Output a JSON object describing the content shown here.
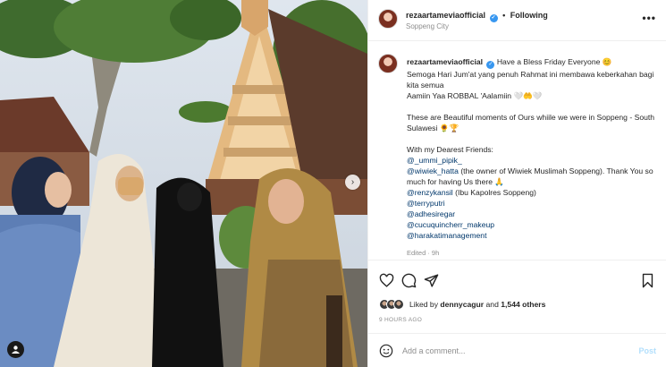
{
  "header": {
    "username": "rezaartameviaofficial",
    "separator": "•",
    "follow_label": "Following",
    "location": "Soppeng City",
    "more_glyph": "•••"
  },
  "caption": {
    "username": "rezaartameviaofficial",
    "line1": "Have a Bless Friday Everyone 😊",
    "line2": "Semoga Hari Jum'at yang penuh Rahmat ini membawa keberkahan bagi kita semua",
    "line3": "Aamiin Yaa ROBBAL 'Aalamiin 🤍🤲🤍",
    "line4": "These are Beautiful moments of Ours whiile we were in Soppeng - South Sulawesi 🌻🏆",
    "line5": "With my Dearest Friends:",
    "mentions": [
      {
        "handle": "@_ummi_pipik_",
        "note": ""
      },
      {
        "handle": "@wiwiek_hatta",
        "note": " (the owner of Wiwiek Muslimah Soppeng). Thank You so much for having Us there 🙏"
      },
      {
        "handle": "@renzykansil",
        "note": " (Ibu Kapolres Soppeng)"
      },
      {
        "handle": "@terryputri",
        "note": ""
      },
      {
        "handle": "@adhesiregar",
        "note": ""
      },
      {
        "handle": "@cucuquincherr_makeup",
        "note": ""
      },
      {
        "handle": "@harakatimanagement",
        "note": ""
      }
    ],
    "edited": "Edited · 9h"
  },
  "likes": {
    "prefix": "Liked by ",
    "user": "dennycagur",
    "joiner": " and ",
    "others": "1,544 others"
  },
  "time_ago": "9 HOURS AGO",
  "comment": {
    "placeholder": "Add a comment...",
    "post_label": "Post"
  },
  "icons": {
    "verified": "verified-badge-icon",
    "heart": "heart-icon",
    "comment": "comment-icon",
    "share": "paper-plane-icon",
    "save": "bookmark-icon",
    "emoji": "smiley-icon",
    "next": "chevron-right-icon",
    "tag": "user-tag-icon"
  },
  "colors": {
    "verified_blue": "#3897f0",
    "link": "#00376b",
    "muted": "#8e8e8e",
    "post_disabled": "#b2dffc"
  }
}
